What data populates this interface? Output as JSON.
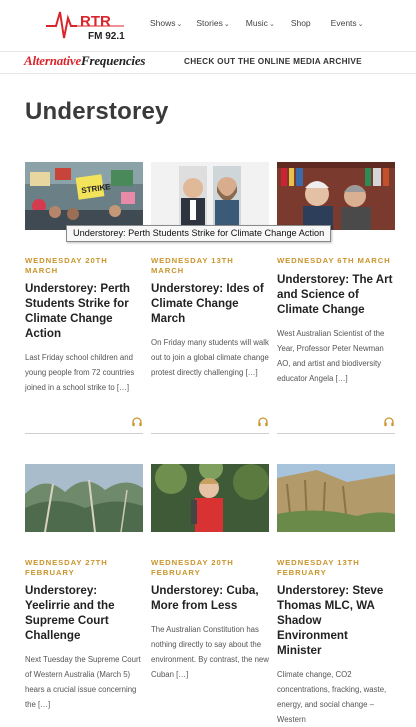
{
  "header": {
    "logo_text": "RTR",
    "logo_sub": "FM 92.1",
    "nav": [
      {
        "label": "Shows",
        "has_dropdown": true
      },
      {
        "label": "Stories",
        "has_dropdown": true
      },
      {
        "label": "Music",
        "has_dropdown": true
      },
      {
        "label": "Shop",
        "has_dropdown": false
      },
      {
        "label": "Events",
        "has_dropdown": true
      }
    ]
  },
  "banner": {
    "brand_part1": "Alternative",
    "brand_part2": "Frequencies",
    "message": "CHECK OUT THE ONLINE MEDIA ARCHIVE"
  },
  "page": {
    "title": "Understorey"
  },
  "tooltip": "Understorey: Perth Students Strike for Climate Change Action",
  "cards": [
    {
      "date": "WEDNESDAY 20TH MARCH",
      "title": "Understorey: Perth Students Strike for Climate Change Action",
      "excerpt": "Last Friday school children and young people from 72 countries joined in a school strike to […]",
      "image": "students-strike-protest",
      "icon": "headphones-icon"
    },
    {
      "date": "WEDNESDAY 13TH MARCH",
      "title": "Understorey: Ides of Climate Change March",
      "excerpt": "On Friday many students will walk out to join a global climate change protest directly challenging […]",
      "image": "two-men-portraits",
      "icon": "headphones-icon"
    },
    {
      "date": "WEDNESDAY 6TH MARCH",
      "title": "Understorey: The Art and Science of Climate Change",
      "excerpt": "West Australian Scientist of the Year, Professor Peter Newman AO, and artist and biodiversity educator Angela […]",
      "image": "two-people-bookshelf",
      "icon": "headphones-icon"
    },
    {
      "date": "WEDNESDAY 27TH FEBRUARY",
      "title": "Understorey: Yeelirrie and the Supreme Court Challenge",
      "excerpt": "Next Tuesday the Supreme Court of Western Australia (March 5) hears a crucial issue concerning the […]",
      "image": "bushland-trees",
      "icon": "headphones-icon"
    },
    {
      "date": "WEDNESDAY 20TH FEBRUARY",
      "title": "Understorey: Cuba, More from Less",
      "excerpt": "The Australian Constitution has nothing directly to say about the environment.  By contrast, the new Cuban […]",
      "image": "man-red-shirt-forest",
      "icon": "headphones-icon"
    },
    {
      "date": "WEDNESDAY 13TH FEBRUARY",
      "title": "Understorey: Steve Thomas MLC, WA Shadow Environment Minister",
      "excerpt": "Climate change, CO2 concentrations, fracking, waste, energy, and social change – Western",
      "image": "limestone-cliff",
      "icon": "headphones-icon"
    }
  ],
  "colors": {
    "accent_date": "#c9952c",
    "brand_red": "#d9262c",
    "title_text": "#222222"
  }
}
